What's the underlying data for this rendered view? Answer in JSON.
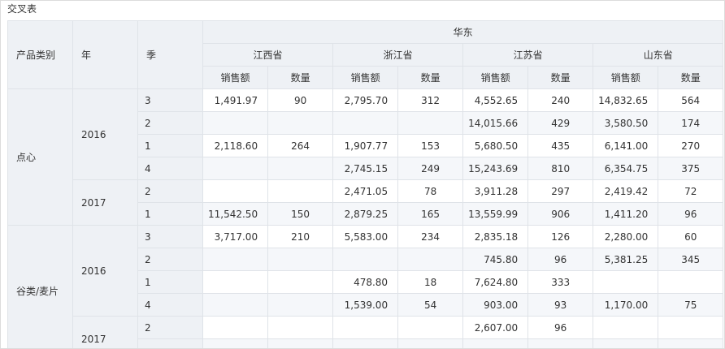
{
  "title": "交叉表",
  "region": "华东",
  "row_header_labels": [
    "产品类别",
    "年",
    "季"
  ],
  "provinces": [
    "江西省",
    "浙江省",
    "江苏省",
    "山东省"
  ],
  "measures": [
    "销售额",
    "数量"
  ],
  "rows": [
    {
      "category": "点心",
      "year": "2016",
      "quarter": "3",
      "values": [
        "1,491.97",
        "90",
        "2,795.70",
        "312",
        "4,552.65",
        "240",
        "14,832.65",
        "564"
      ]
    },
    {
      "category": "",
      "year": "",
      "quarter": "2",
      "values": [
        "",
        "",
        "",
        "",
        "14,015.66",
        "429",
        "3,580.50",
        "174"
      ]
    },
    {
      "category": "",
      "year": "",
      "quarter": "1",
      "values": [
        "2,118.60",
        "264",
        "1,907.77",
        "153",
        "5,680.50",
        "435",
        "6,141.00",
        "270"
      ]
    },
    {
      "category": "",
      "year": "",
      "quarter": "4",
      "values": [
        "",
        "",
        "2,745.15",
        "249",
        "15,243.69",
        "810",
        "6,354.75",
        "375"
      ]
    },
    {
      "category": "",
      "year": "2017",
      "quarter": "2",
      "values": [
        "",
        "",
        "2,471.05",
        "78",
        "3,911.28",
        "297",
        "2,419.42",
        "72"
      ]
    },
    {
      "category": "",
      "year": "",
      "quarter": "1",
      "values": [
        "11,542.50",
        "150",
        "2,879.25",
        "165",
        "13,559.99",
        "906",
        "1,411.20",
        "96"
      ]
    },
    {
      "category": "谷类/麦片",
      "year": "2016",
      "quarter": "3",
      "values": [
        "3,717.00",
        "210",
        "5,583.00",
        "234",
        "2,835.18",
        "126",
        "2,280.00",
        "60"
      ]
    },
    {
      "category": "",
      "year": "",
      "quarter": "2",
      "values": [
        "",
        "",
        "",
        "",
        "745.80",
        "96",
        "5,381.25",
        "345"
      ]
    },
    {
      "category": "",
      "year": "",
      "quarter": "1",
      "values": [
        "",
        "",
        "478.80",
        "18",
        "7,624.80",
        "333",
        "",
        ""
      ]
    },
    {
      "category": "",
      "year": "",
      "quarter": "4",
      "values": [
        "",
        "",
        "1,539.00",
        "54",
        "903.00",
        "93",
        "1,170.00",
        "75"
      ]
    },
    {
      "category": "",
      "year": "2017",
      "quarter": "2",
      "values": [
        "",
        "",
        "",
        "",
        "2,607.00",
        "96",
        "",
        ""
      ]
    },
    {
      "category": "",
      "year": "",
      "quarter": "",
      "values": [
        "",
        "",
        "",
        "",
        "",
        "",
        "",
        ""
      ]
    }
  ]
}
